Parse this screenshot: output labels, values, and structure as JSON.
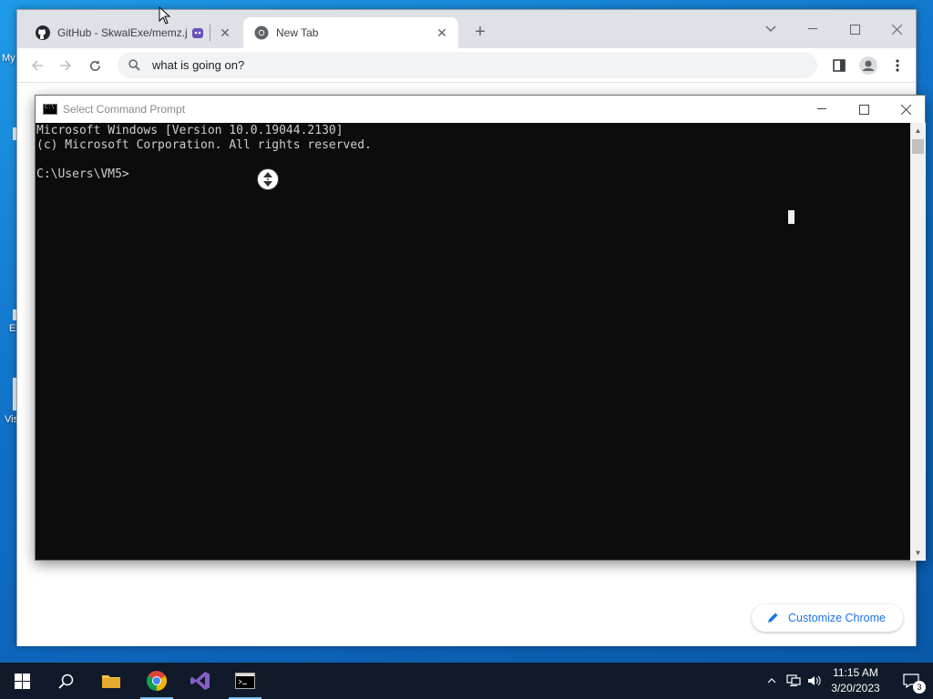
{
  "desktop": {
    "icon_labels": [
      "My",
      "E",
      "Vis"
    ]
  },
  "chrome": {
    "tabs": [
      {
        "title": "GitHub - SkwalExe/memz.js:",
        "active": false
      },
      {
        "title": "New Tab",
        "active": true
      }
    ],
    "omnibox": {
      "value": "what is going on?"
    },
    "customize_label": "Customize Chrome",
    "accent_color": "#1a73e8"
  },
  "cmd": {
    "title": "Select Command Prompt",
    "lines": [
      "Microsoft Windows [Version 10.0.19044.2130]",
      "(c) Microsoft Corporation. All rights reserved.",
      "",
      "C:\\Users\\VM5>"
    ]
  },
  "taskbar": {
    "apps": [
      "start-icon",
      "search-icon",
      "file-explorer-icon",
      "chrome-icon",
      "visual-studio-icon",
      "command-prompt-icon"
    ],
    "time": "11:15 AM",
    "date": "3/20/2023",
    "notification_count": "3"
  }
}
